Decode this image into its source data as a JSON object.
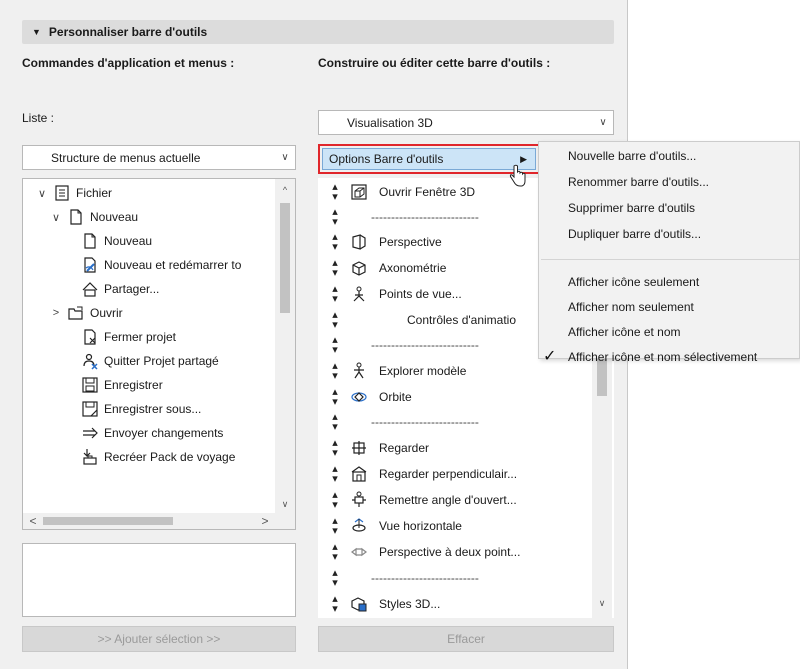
{
  "section": {
    "title": "Personnaliser barre d'outils"
  },
  "left": {
    "title": "Commandes d'application et menus :",
    "list_label": "Liste :",
    "dropdown_value": "Structure de menus actuelle",
    "tree": [
      {
        "label": "Fichier",
        "icon": "file-menu-icon",
        "expander": "down"
      },
      {
        "label": "Nouveau",
        "icon": "new-document-icon",
        "expander": "down"
      },
      {
        "label": "Nouveau",
        "icon": "new-document-icon",
        "expander": ""
      },
      {
        "label": "Nouveau et redémarrer to",
        "icon": "new-restart-icon",
        "expander": ""
      },
      {
        "label": "Partager...",
        "icon": "share-house-icon",
        "expander": ""
      },
      {
        "label": "Ouvrir",
        "icon": "open-folder-icon",
        "expander": "right"
      },
      {
        "label": "Fermer projet",
        "icon": "close-project-icon",
        "expander": ""
      },
      {
        "label": "Quitter Projet partagé",
        "icon": "leave-shared-icon",
        "expander": ""
      },
      {
        "label": "Enregistrer",
        "icon": "save-icon",
        "expander": ""
      },
      {
        "label": "Enregistrer sous...",
        "icon": "save-as-icon",
        "expander": ""
      },
      {
        "label": "Envoyer changements",
        "icon": "send-arrow-icon",
        "expander": ""
      },
      {
        "label": "Recréer Pack de voyage",
        "icon": "travel-pack-icon",
        "expander": ""
      }
    ],
    "add_button": ">> Ajouter sélection >>"
  },
  "right": {
    "title": "Construire ou éditer cette barre d'outils :",
    "dropdown_value": "Visualisation 3D",
    "options_button": "Options Barre d'outils",
    "toolbar_items": [
      {
        "label": "Ouvrir Fenêtre 3D",
        "icon": "open-3d-window-icon"
      },
      {
        "label": "---------------------------",
        "icon": ""
      },
      {
        "label": "Perspective",
        "icon": "perspective-icon"
      },
      {
        "label": "Axonométrie",
        "icon": "axonometry-icon"
      },
      {
        "label": "Points de vue...",
        "icon": "viewpoints-icon"
      },
      {
        "label": "Contrôles d'animatio",
        "icon": ""
      },
      {
        "label": "---------------------------",
        "icon": ""
      },
      {
        "label": "Explorer modèle",
        "icon": "explore-model-icon"
      },
      {
        "label": "Orbite",
        "icon": "orbit-icon"
      },
      {
        "label": "---------------------------",
        "icon": ""
      },
      {
        "label": "Regarder",
        "icon": "look-icon"
      },
      {
        "label": "Regarder perpendiculair...",
        "icon": "look-perpendicular-icon"
      },
      {
        "label": "Remettre angle d'ouvert...",
        "icon": "reset-angle-icon"
      },
      {
        "label": "Vue horizontale",
        "icon": "horizontal-view-icon"
      },
      {
        "label": "Perspective à deux point...",
        "icon": "two-point-perspective-icon"
      },
      {
        "label": "---------------------------",
        "icon": ""
      },
      {
        "label": "Styles 3D...",
        "icon": "styles-3d-icon"
      }
    ],
    "clear_button": "Effacer"
  },
  "menu": {
    "items_top": [
      "Nouvelle barre d'outils...",
      "Renommer barre d'outils...",
      "Supprimer barre d'outils",
      "Dupliquer barre d'outils..."
    ],
    "items_bottom": [
      "Afficher icône seulement",
      "Afficher nom seulement",
      "Afficher icône et nom",
      "Afficher icône et nom sélectivement"
    ],
    "checked_label": "Afficher icône et nom sélectivement"
  },
  "colors": {
    "highlight_border": "#e0262b",
    "selected_fill": "#cce4f7",
    "panel_bg": "#f0f0f0"
  }
}
